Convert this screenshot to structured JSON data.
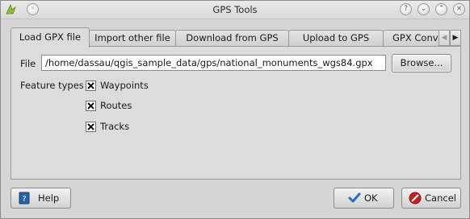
{
  "window": {
    "title": "GPS Tools",
    "controls": [
      "help-icon",
      "minimize-icon",
      "maximize-icon",
      "close-icon"
    ]
  },
  "tabs": [
    {
      "label": "Load GPX file",
      "active": true
    },
    {
      "label": "Import other file",
      "active": false
    },
    {
      "label": "Download from GPS",
      "active": false
    },
    {
      "label": "Upload to GPS",
      "active": false
    },
    {
      "label": "GPX Convers",
      "active": false
    }
  ],
  "load_gpx": {
    "file_label": "File",
    "file_path": "/home/dassau/qgis_sample_data/gps/national_monuments_wgs84.gpx",
    "browse_label": "Browse...",
    "feature_types_label": "Feature types",
    "feature_types": [
      {
        "label": "Waypoints",
        "checked": true
      },
      {
        "label": "Routes",
        "checked": true
      },
      {
        "label": "Tracks",
        "checked": true
      }
    ]
  },
  "buttons": {
    "help": "Help",
    "ok": "OK",
    "cancel": "Cancel"
  },
  "colors": {
    "background": "#d6d6d6",
    "ok_check": "#2f6db5",
    "cancel_icon": "#c62020"
  }
}
